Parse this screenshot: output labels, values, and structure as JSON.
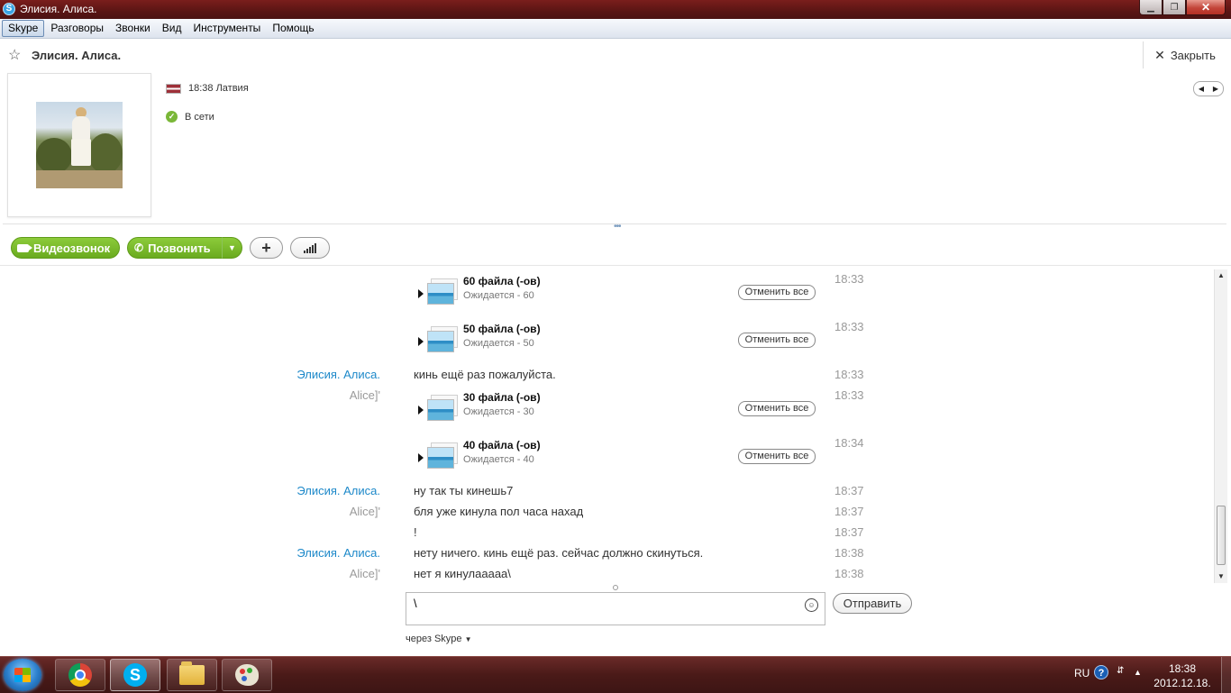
{
  "window": {
    "title": "Элисия. Алиса.",
    "app_icon": "skype-icon",
    "controls": {
      "minimize": "minimize-icon",
      "maximize": "restore-icon",
      "close": "close-icon"
    }
  },
  "menu": {
    "items": [
      "Skype",
      "Разговоры",
      "Звонки",
      "Вид",
      "Инструменты",
      "Помощь"
    ]
  },
  "conversation": {
    "title": "Элисия. Алиса.",
    "close_label": "Закрыть"
  },
  "profile": {
    "local_time": "18:38 Латвия",
    "status": "В сети"
  },
  "call_toolbar": {
    "video_label": "Видеозвонок",
    "call_label": "Позвонить"
  },
  "chat": {
    "messages": [
      {
        "type": "file",
        "title": "60 файла (-ов)",
        "sub": "Ожидается - 60",
        "cancel": "Отменить все",
        "time": "18:33"
      },
      {
        "type": "file",
        "title": "50 файла (-ов)",
        "sub": "Ожидается - 50",
        "cancel": "Отменить все",
        "time": "18:33"
      },
      {
        "type": "text",
        "name": "Элисия. Алиса.",
        "text": "кинь ещё раз пожалуйста.",
        "time": "18:33"
      },
      {
        "type": "name",
        "name": "Alice]'"
      },
      {
        "type": "file",
        "title": "30 файла (-ов)",
        "sub": "Ожидается - 30",
        "cancel": "Отменить все",
        "time": "18:33"
      },
      {
        "type": "file",
        "title": "40 файла (-ов)",
        "sub": "Ожидается - 40",
        "cancel": "Отменить все",
        "time": "18:34"
      },
      {
        "type": "text",
        "name": "Элисия. Алиса.",
        "text": "ну так ты кинешь7",
        "time": "18:37"
      },
      {
        "type": "text",
        "name": "Alice]'",
        "text": "бля уже кинула пол часа нахад",
        "time": "18:37"
      },
      {
        "type": "text",
        "name": "",
        "text": "!",
        "time": "18:37"
      },
      {
        "type": "text",
        "name": "Элисия. Алиса.",
        "text": "нету ничего. кинь ещё раз. сейчас должно скинуться.",
        "time": "18:38"
      },
      {
        "type": "text",
        "name": "Alice]'",
        "text": "нет я кинулааааа\\",
        "time": "18:38"
      }
    ]
  },
  "composer": {
    "value": "\\",
    "send_label": "Отправить",
    "via_label": "через Skype"
  },
  "taskbar": {
    "apps": [
      "chrome-icon",
      "skype-icon",
      "explorer-folder-icon",
      "paint-icon"
    ],
    "language": "RU",
    "time": "18:38",
    "date": "2012.12.18."
  },
  "colors": {
    "titlebar": "#5a1514",
    "green_button": "#7ab829",
    "name_primary": "#1c88c9",
    "name_secondary": "#9a9a9a"
  }
}
